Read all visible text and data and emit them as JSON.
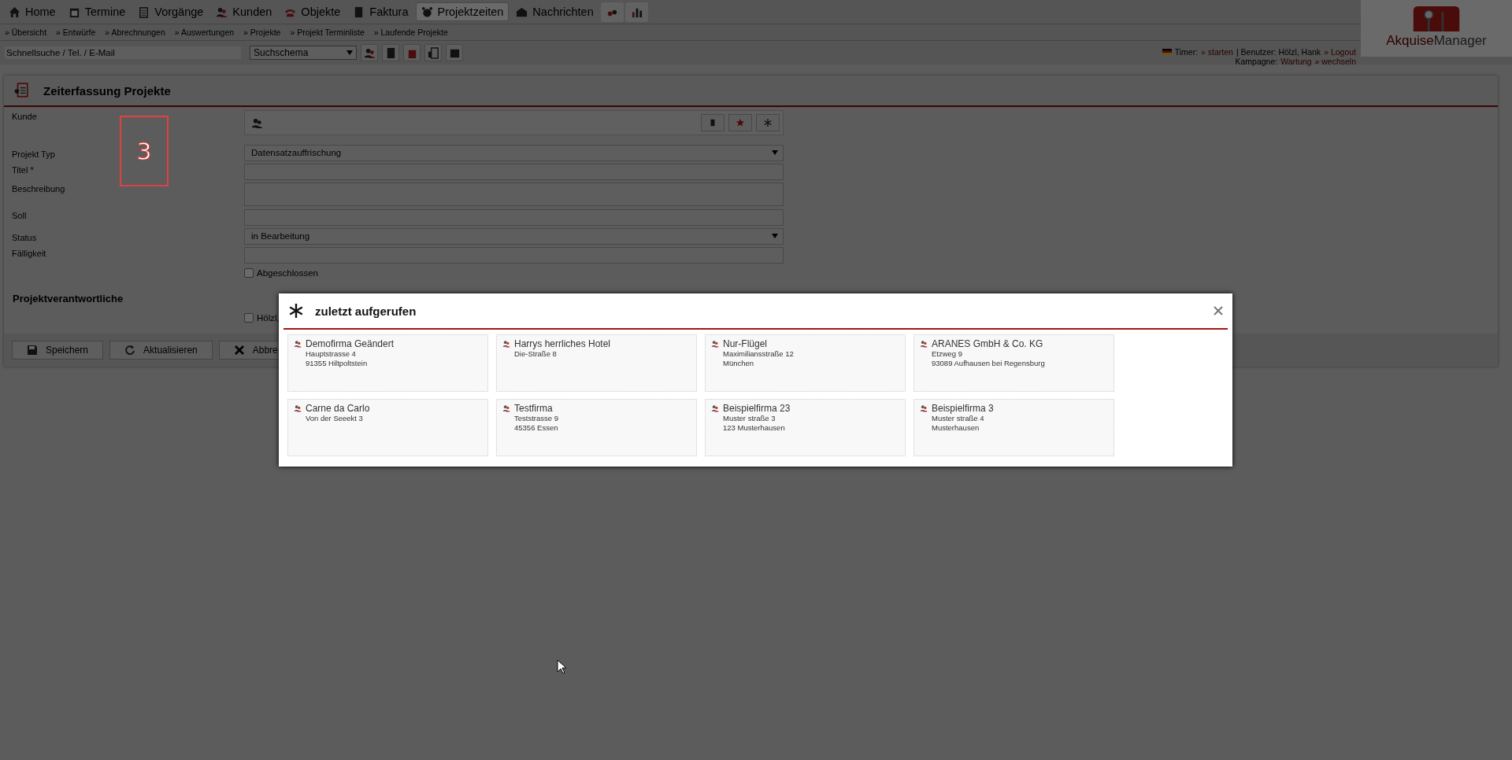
{
  "nav": {
    "tabs": [
      {
        "label": "Home",
        "selected": false
      },
      {
        "label": "Termine",
        "selected": false
      },
      {
        "label": "Vorgänge",
        "selected": false
      },
      {
        "label": "Kunden",
        "selected": false
      },
      {
        "label": "Objekte",
        "selected": false
      },
      {
        "label": "Faktura",
        "selected": false
      },
      {
        "label": "Projektzeiten",
        "selected": true
      },
      {
        "label": "Nachrichten",
        "selected": false
      }
    ]
  },
  "subnav": [
    "» Übersicht",
    "» Entwürfe",
    "» Abrechnungen",
    "» Auswertungen",
    "» Projekte",
    "» Projekt Terminliste",
    "» Laufende Projekte"
  ],
  "search": {
    "placeholder": "Schnellsuche / Tel. / E-Mail",
    "schema": "Suchschema"
  },
  "user_info": {
    "timer_label": "Timer:",
    "timer_link": "» starten",
    "user_text": "| Benutzer: Hölzl, Hank",
    "logout": "» Logout",
    "campaign_label": "Kampagne:",
    "campaign": "Wartung",
    "change": "» wechseln"
  },
  "logo": {
    "part_1": "Akquise",
    "part_2": "Manager"
  },
  "panel": {
    "title": "Zeiterfassung Projekte",
    "fields": [
      {
        "label": "Kunde",
        "kind": "customer"
      },
      {
        "label": "Projekt Typ",
        "kind": "select",
        "value": "Datensatzauffrischung"
      },
      {
        "label": "Titel *",
        "kind": "text"
      },
      {
        "label": "Beschreibung",
        "kind": "textarea"
      },
      {
        "label": "Soll",
        "kind": "text"
      },
      {
        "label": "Status",
        "kind": "select",
        "value": "in Bearbeitung"
      },
      {
        "label": "Fälligkeit",
        "kind": "text"
      }
    ],
    "done": {
      "label": "Abgeschlossen",
      "checked": false
    },
    "section": "Projektverantwortliche",
    "people": [
      {
        "label": "Hölzl,",
        "checked": false
      }
    ],
    "buttons": [
      "Speichern",
      "Aktualisieren",
      "Abbre"
    ]
  },
  "annotation": {
    "label": "3"
  },
  "modal": {
    "title": "zuletzt aufgerufen",
    "cards": [
      {
        "name": "Demofirma Geändert",
        "lines": [
          "Hauptstrasse 4",
          "91355 Hiltpoltstein"
        ]
      },
      {
        "name": "Harrys herrliches Hotel",
        "lines": [
          "Die-Straße 8"
        ]
      },
      {
        "name": "Nur-Flügel",
        "lines": [
          "Maximiliansstraße 12",
          "München"
        ]
      },
      {
        "name": "ARANES GmbH & Co. KG",
        "lines": [
          "Etzweg 9",
          "93089 Aufhausen bei Regensburg"
        ]
      },
      {
        "name": "Carne da Carlo",
        "lines": [
          "Von der Seeekt 3"
        ]
      },
      {
        "name": "Testfirma",
        "lines": [
          "Teststrasse 9",
          "45356 Essen"
        ]
      },
      {
        "name": "Beispielfirma 23",
        "lines": [
          "Muster straße 3",
          "123 Musterhausen"
        ]
      },
      {
        "name": "Beispielfirma 3",
        "lines": [
          "Muster straße 4",
          "Musterhausen"
        ]
      }
    ]
  }
}
